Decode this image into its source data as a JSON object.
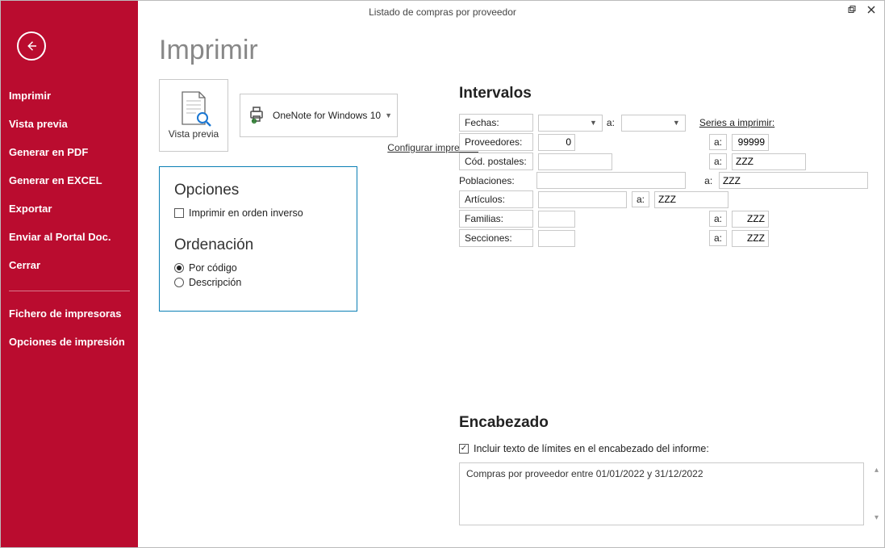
{
  "window": {
    "title": "Listado de compras por proveedor"
  },
  "sidebar": {
    "items": [
      "Imprimir",
      "Vista previa",
      "Generar en PDF",
      "Generar en EXCEL",
      "Exportar",
      "Enviar al Portal Doc.",
      "Cerrar"
    ],
    "items2": [
      "Fichero de impresoras",
      "Opciones de impresión"
    ]
  },
  "page": {
    "heading": "Imprimir"
  },
  "preview": {
    "label": "Vista previa"
  },
  "printer": {
    "name": "OneNote for Windows 10",
    "configure": "Configurar impresora"
  },
  "options": {
    "heading": "Opciones",
    "reverse": "Imprimir en orden inverso",
    "order_heading": "Ordenación",
    "by_code": "Por código",
    "by_desc": "Descripción"
  },
  "intervals": {
    "heading": "Intervalos",
    "labels": {
      "fechas": "Fechas:",
      "proveedores": "Proveedores:",
      "codpostales": "Cód. postales:",
      "poblaciones": "Poblaciones:",
      "articulos": "Artículos:",
      "familias": "Familias:",
      "secciones": "Secciones:",
      "a": "a:",
      "series": "Series a imprimir:"
    },
    "values": {
      "fecha_from": "",
      "fecha_to": "",
      "prov_from": "0",
      "prov_to": "99999",
      "cp_from": "",
      "cp_to": "ZZZ",
      "pob_from": "",
      "pob_to": "ZZZ",
      "art_from": "",
      "art_to": "ZZZ",
      "fam_from": "",
      "fam_to": "ZZZ",
      "sec_from": "",
      "sec_to": "ZZZ"
    }
  },
  "encabezado": {
    "heading": "Encabezado",
    "include_label": "Incluir texto de límites en el encabezado del informe:",
    "text": "Compras por proveedor entre 01/01/2022 y 31/12/2022"
  }
}
